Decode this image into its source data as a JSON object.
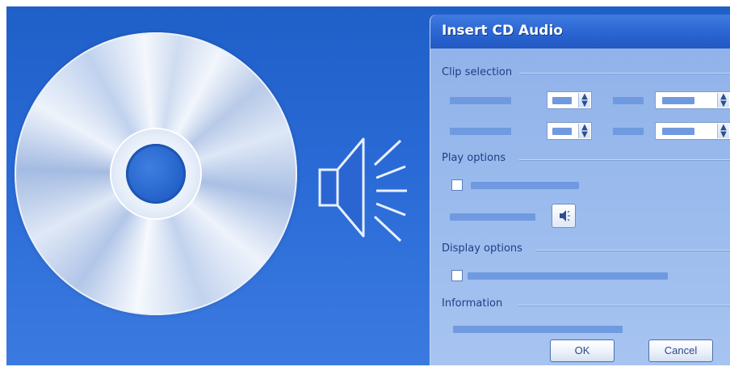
{
  "dialog": {
    "title": "Insert CD Audio",
    "sections": {
      "clip_selection": "Clip selection",
      "play_options": "Play options",
      "display_options": "Display options",
      "information": "Information"
    },
    "buttons": {
      "ok": "OK",
      "cancel": "Cancel"
    }
  },
  "icons": {
    "cd": "cd-disc-icon",
    "speaker": "speaker-icon",
    "volume_button": "volume-icon"
  },
  "colors": {
    "background": "#2a6ad6",
    "title_bar": "#2a65d2",
    "dialog_body": "#9cbcee",
    "section_text": "#1c3f86"
  }
}
